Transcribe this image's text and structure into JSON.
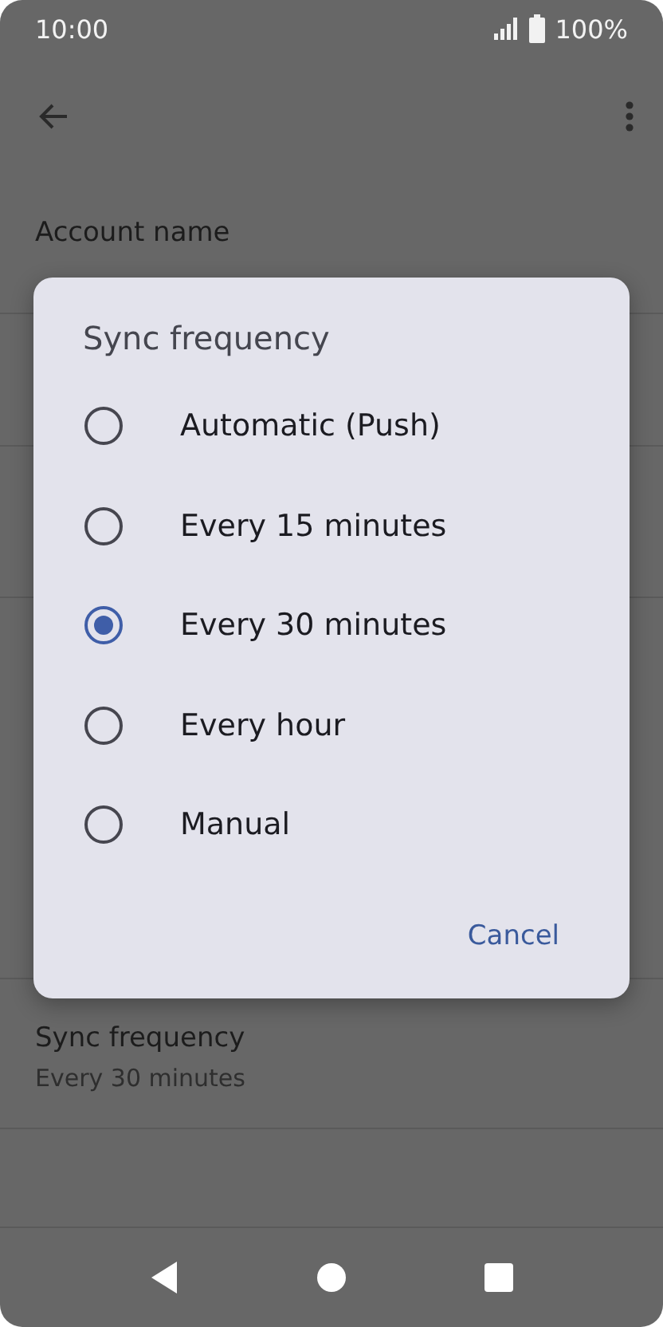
{
  "status_bar": {
    "time": "10:00",
    "battery": "100%"
  },
  "settings": [
    {
      "title": "Account name"
    },
    {
      "title": "Sync frequency",
      "value": "Every 30 minutes"
    }
  ],
  "dialog": {
    "title": "Sync frequency",
    "options": [
      {
        "label": "Automatic (Push)",
        "selected": false
      },
      {
        "label": "Every 15 minutes",
        "selected": false
      },
      {
        "label": "Every 30 minutes",
        "selected": true
      },
      {
        "label": "Every hour",
        "selected": false
      },
      {
        "label": "Manual",
        "selected": false
      }
    ],
    "cancel": "Cancel"
  }
}
